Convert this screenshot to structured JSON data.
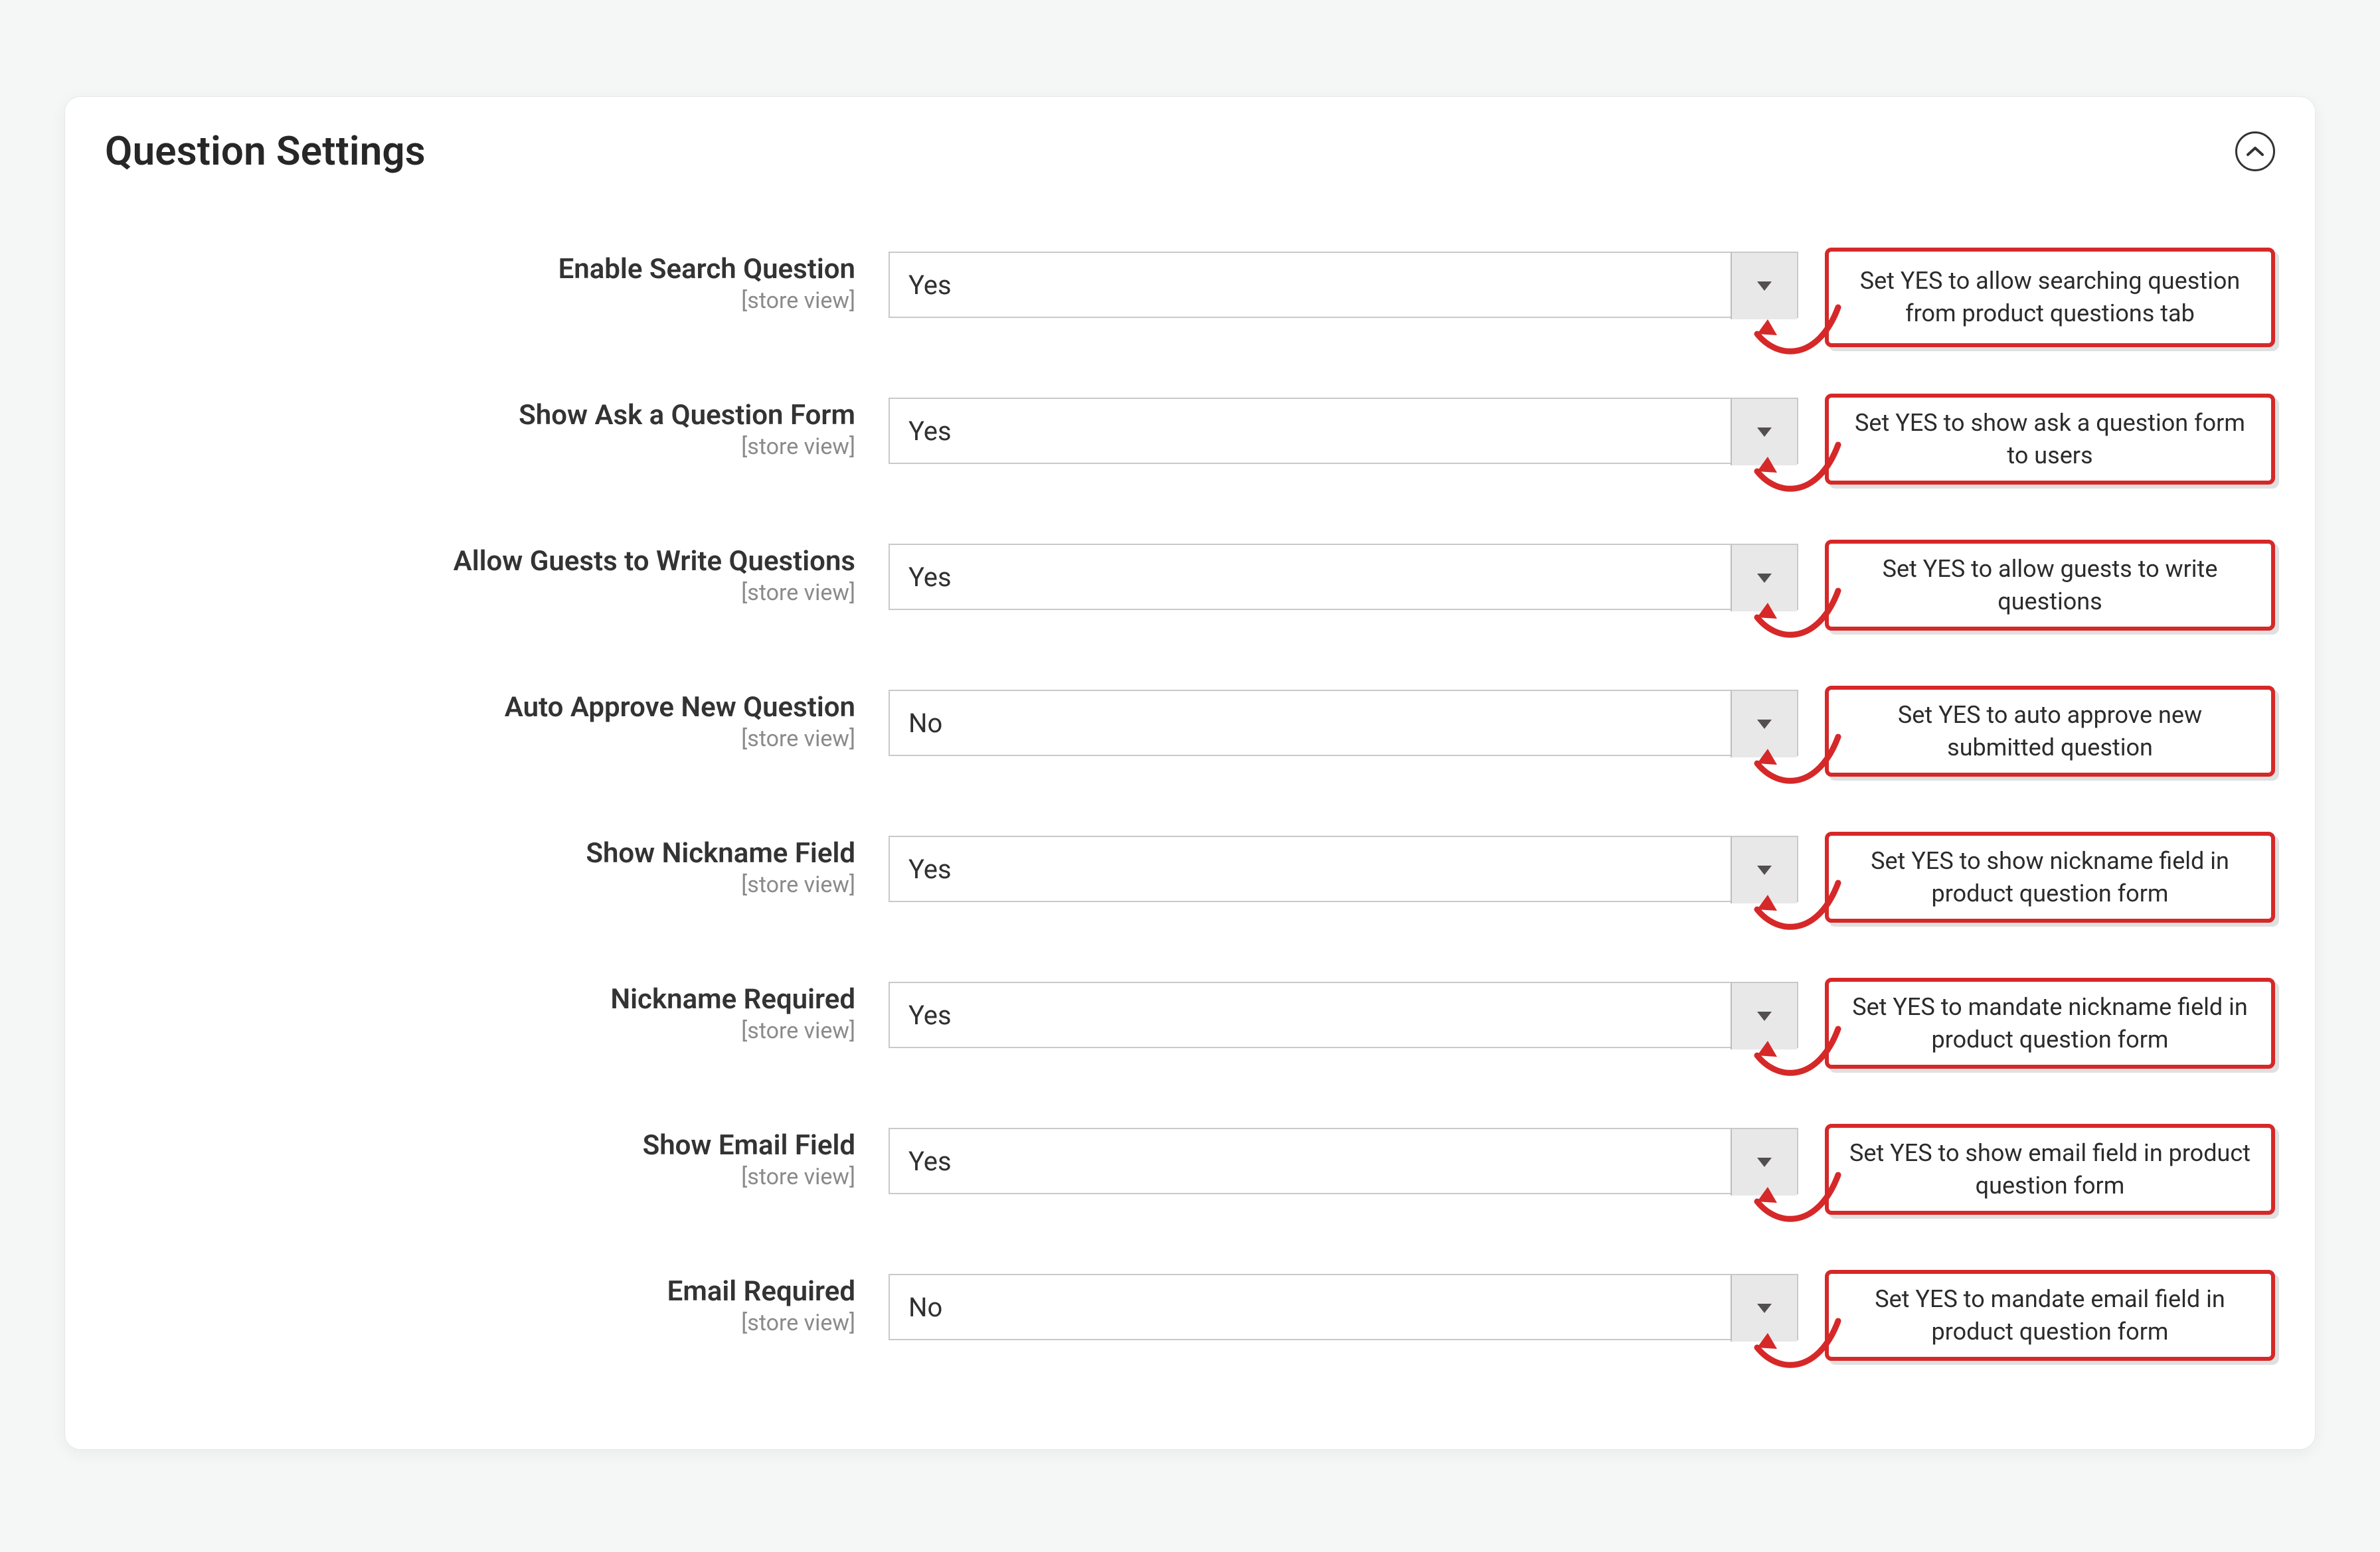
{
  "panel": {
    "title": "Question Settings",
    "scope_text": "[store view]"
  },
  "fields": [
    {
      "label": "Enable Search Question",
      "value": "Yes",
      "annotation": "Set YES to allow searching question from product questions tab"
    },
    {
      "label": "Show Ask a Question Form",
      "value": "Yes",
      "annotation": "Set YES to show ask a question form to users"
    },
    {
      "label": "Allow Guests to Write Questions",
      "value": "Yes",
      "annotation": "Set YES to allow guests to write questions"
    },
    {
      "label": "Auto Approve New Question",
      "value": "No",
      "annotation": "Set YES to auto approve new submitted question"
    },
    {
      "label": "Show Nickname Field",
      "value": "Yes",
      "annotation": "Set YES to show nickname field in product question form"
    },
    {
      "label": "Nickname Required",
      "value": "Yes",
      "annotation": "Set YES to mandate nickname field in product question form"
    },
    {
      "label": "Show Email Field",
      "value": "Yes",
      "annotation": "Set YES to show email field in product question form"
    },
    {
      "label": "Email Required",
      "value": "No",
      "annotation": "Set YES to mandate email field in product question form"
    }
  ]
}
